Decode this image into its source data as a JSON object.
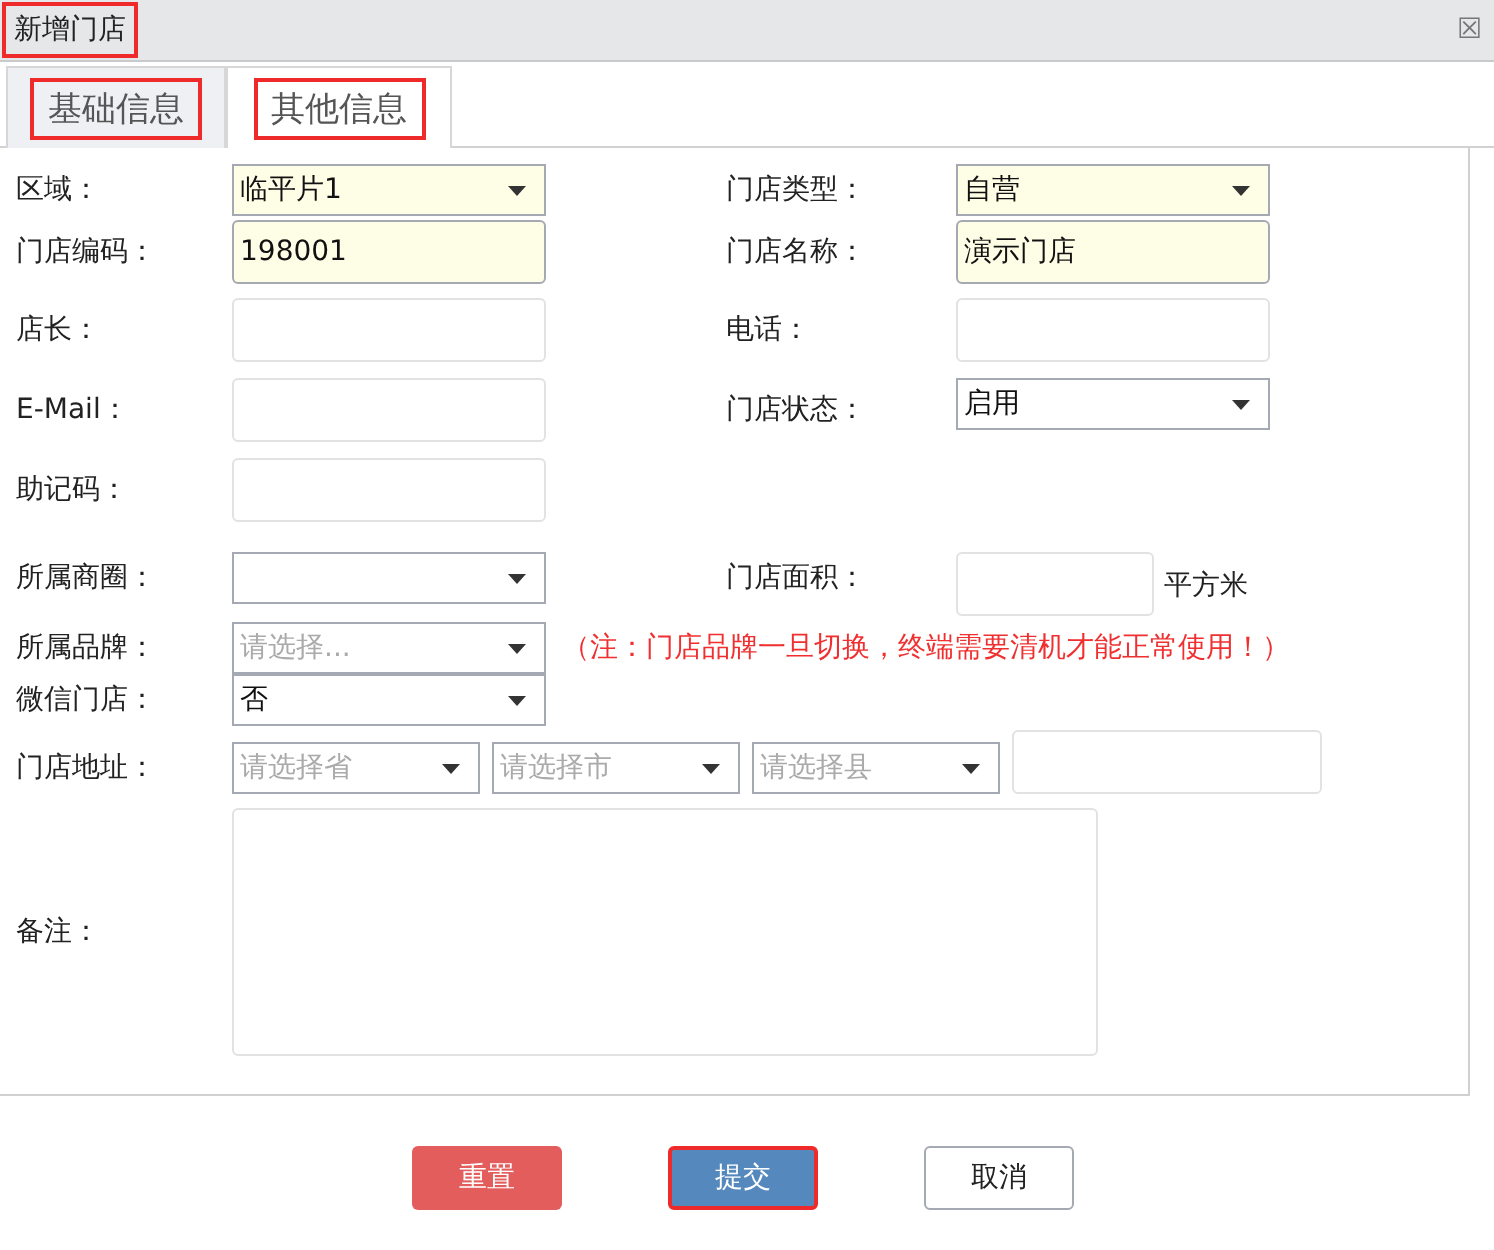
{
  "window": {
    "title": "新增门店",
    "highlighted": true,
    "close": "☒"
  },
  "tabs": [
    {
      "label": "基础信息",
      "selected": true,
      "highlighted": true
    },
    {
      "label": "其他信息",
      "selected": false,
      "highlighted": true
    }
  ],
  "rows": [
    {
      "cells": [
        {
          "label": "区域：",
          "fields": [
            {
              "kind": "select",
              "value": "临平片1",
              "required": true
            }
          ]
        },
        {
          "label": "门店类型：",
          "fields": [
            {
              "kind": "select",
              "value": "自营",
              "required": true
            }
          ]
        }
      ]
    },
    {
      "cells": [
        {
          "label": "门店编码：",
          "fields": [
            {
              "kind": "input",
              "value": "198001",
              "required": true
            }
          ]
        },
        {
          "label": "门店名称：",
          "fields": [
            {
              "kind": "input",
              "value": "演示门店",
              "required": true
            }
          ]
        }
      ]
    },
    {
      "cells": [
        {
          "label": "店长：",
          "fields": [
            {
              "kind": "input",
              "required": false
            }
          ]
        },
        {
          "label": "电话：",
          "fields": [
            {
              "kind": "input",
              "required": false
            }
          ]
        }
      ]
    },
    {
      "cells": [
        {
          "label": "E-Mail：",
          "fields": [
            {
              "kind": "input",
              "required": false
            }
          ]
        },
        {
          "label": "门店状态：",
          "fields": [
            {
              "kind": "select",
              "value": "启用",
              "required": false
            }
          ]
        }
      ]
    },
    {
      "cells": [
        {
          "label": "助记码：",
          "fields": [
            {
              "kind": "input",
              "required": false
            }
          ]
        }
      ]
    },
    {
      "cells": [
        {
          "label": "所属商圈：",
          "fields": [
            {
              "kind": "select",
              "required": false
            }
          ]
        },
        {
          "label": "门店面积：",
          "fields": [
            {
              "kind": "short-input",
              "required": false,
              "unit": "平方米"
            }
          ]
        }
      ]
    },
    {
      "cells": [
        {
          "label": "所属品牌：",
          "fields": [
            {
              "kind": "select",
              "placeholder": "请选择...",
              "required": false
            }
          ],
          "note": "（注：门店品牌一旦切换，终端需要清机才能正常使用！）"
        }
      ]
    },
    {
      "cells": [
        {
          "label": "微信门店：",
          "fields": [
            {
              "kind": "select",
              "value": "否",
              "required": false
            }
          ]
        }
      ]
    },
    {
      "cells": [
        {
          "label": "门店地址：",
          "fields": [
            {
              "kind": "small-select",
              "placeholder": "请选择省",
              "required": false
            },
            {
              "kind": "small-select",
              "placeholder": "请选择市",
              "required": false
            },
            {
              "kind": "small-select",
              "placeholder": "请选择县",
              "required": false
            },
            {
              "kind": "input",
              "required": false
            }
          ]
        }
      ]
    },
    {
      "cells": [
        {
          "label": "备注：",
          "fields": [
            {
              "kind": "textarea",
              "required": false
            }
          ]
        }
      ]
    }
  ],
  "buttons": [
    {
      "label": "重置",
      "kind": "reset",
      "highlighted": false
    },
    {
      "label": "提交",
      "kind": "submit",
      "highlighted": true
    },
    {
      "label": "取消",
      "kind": "cancel",
      "highlighted": false
    }
  ]
}
